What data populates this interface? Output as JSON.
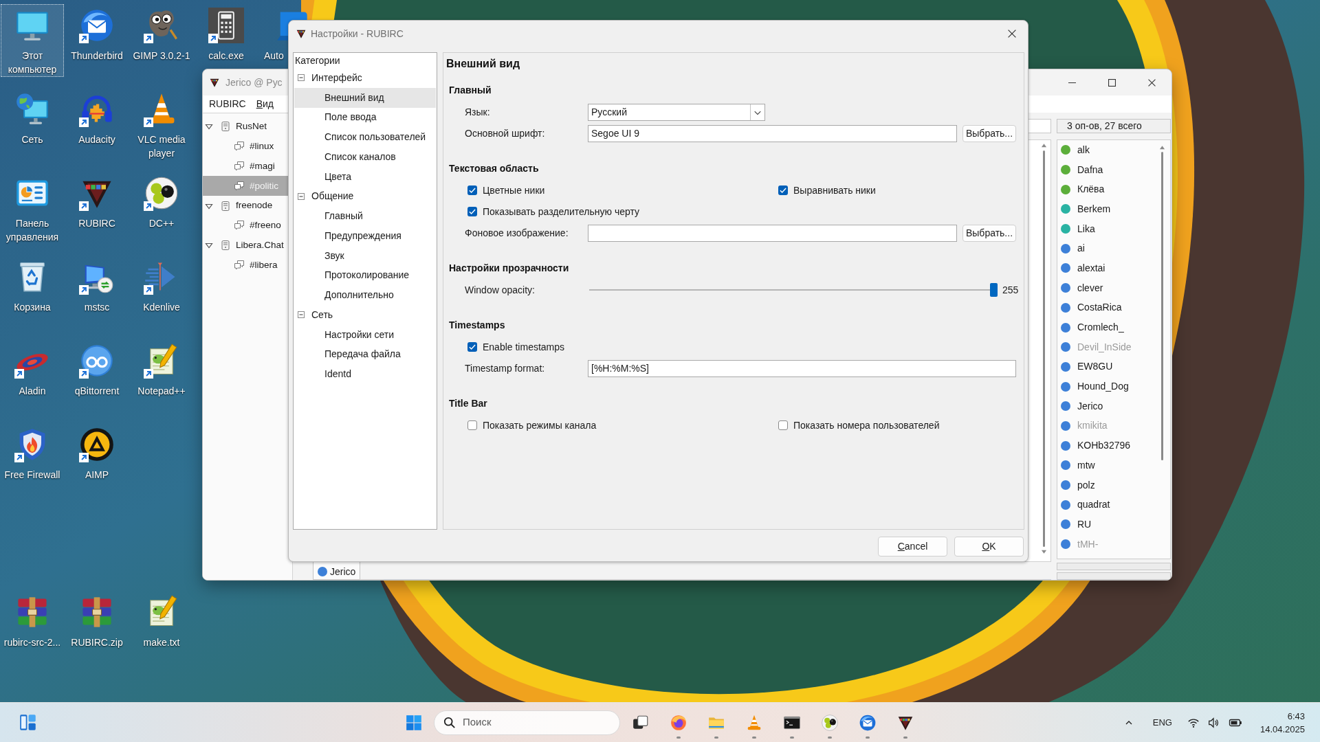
{
  "desktop": {
    "columns": [
      [
        {
          "label": "Этот компьютер",
          "shortcut": false,
          "selected": true
        },
        {
          "label": "Сеть",
          "shortcut": false,
          "selected": false
        },
        {
          "label": "Панель управления",
          "shortcut": false,
          "selected": false
        },
        {
          "label": "Корзина",
          "shortcut": false,
          "selected": false
        },
        {
          "label": "Aladin",
          "shortcut": true,
          "selected": false
        },
        {
          "label": "Free Firewall",
          "shortcut": true,
          "selected": false
        }
      ],
      [
        {
          "label": "Thunderbird",
          "shortcut": true,
          "selected": false
        },
        {
          "label": "Audacity",
          "shortcut": true,
          "selected": false
        },
        {
          "label": "RUBIRC",
          "shortcut": true,
          "selected": false
        },
        {
          "label": "mstsc",
          "shortcut": true,
          "selected": false
        },
        {
          "label": "qBittorrent",
          "shortcut": true,
          "selected": false
        },
        {
          "label": "AIMP",
          "shortcut": true,
          "selected": false
        }
      ],
      [
        {
          "label": "GIMP 3.0.2-1",
          "shortcut": true,
          "selected": false
        },
        {
          "label": "VLC media player",
          "shortcut": true,
          "selected": false
        },
        {
          "label": "DC++",
          "shortcut": true,
          "selected": false
        },
        {
          "label": "Kdenlive",
          "shortcut": true,
          "selected": false
        },
        {
          "label": "Notepad++",
          "shortcut": true,
          "selected": false
        }
      ],
      [
        {
          "label": "calc.exe",
          "shortcut": true,
          "selected": false
        }
      ],
      [
        {
          "label": "Auto",
          "shortcut": false,
          "selected": false
        }
      ]
    ],
    "bottom_row": [
      {
        "label": "rubirc-src-2...",
        "shortcut": false,
        "selected": false
      },
      {
        "label": "RUBIRC.zip",
        "shortcut": false,
        "selected": false
      },
      {
        "label": "make.txt",
        "shortcut": false,
        "selected": false
      }
    ]
  },
  "chat_window": {
    "title": "Jerico @ Рус",
    "menu": [
      {
        "label": "RUBIRC",
        "mnemonic": false
      },
      {
        "label": "Вид",
        "mnemonic": true
      }
    ],
    "server_tree": [
      {
        "label": "RusNet",
        "expanded": true,
        "selected": false,
        "children": [
          {
            "label": "#linux",
            "selected": false
          },
          {
            "label": "#magi",
            "selected": false
          },
          {
            "label": "#politic",
            "selected": true
          }
        ]
      },
      {
        "label": "freenode",
        "expanded": true,
        "selected": false,
        "children": [
          {
            "label": "#freeno",
            "selected": false
          }
        ]
      },
      {
        "label": "Libera.Chat",
        "expanded": true,
        "selected": false,
        "children": [
          {
            "label": "#libera",
            "selected": false
          }
        ]
      }
    ],
    "user_list": {
      "header": "3 оп-ов, 27 всего",
      "users": [
        {
          "nick": "alk",
          "color": "#5cae3a",
          "away": false
        },
        {
          "nick": "Dafna",
          "color": "#5cae3a",
          "away": false
        },
        {
          "nick": "Клёва",
          "color": "#5cae3a",
          "away": false
        },
        {
          "nick": "Berkem",
          "color": "#2ab3a3",
          "away": false
        },
        {
          "nick": "Lika",
          "color": "#2ab3a3",
          "away": false
        },
        {
          "nick": "ai",
          "color": "#3d80d8",
          "away": false
        },
        {
          "nick": "alextai",
          "color": "#3d80d8",
          "away": false
        },
        {
          "nick": "clever",
          "color": "#3d80d8",
          "away": false
        },
        {
          "nick": "CostaRica",
          "color": "#3d80d8",
          "away": false
        },
        {
          "nick": "Cromlech_",
          "color": "#3d80d8",
          "away": false
        },
        {
          "nick": "Devil_InSide",
          "color": "#3d80d8",
          "away": true
        },
        {
          "nick": "EW8GU",
          "color": "#3d80d8",
          "away": false
        },
        {
          "nick": "Hound_Dog",
          "color": "#3d80d8",
          "away": false
        },
        {
          "nick": "Jerico",
          "color": "#3d80d8",
          "away": false
        },
        {
          "nick": "kmikita",
          "color": "#3d80d8",
          "away": true
        },
        {
          "nick": "KOHb32796",
          "color": "#3d80d8",
          "away": false
        },
        {
          "nick": "mtw",
          "color": "#3d80d8",
          "away": false
        },
        {
          "nick": "polz",
          "color": "#3d80d8",
          "away": false
        },
        {
          "nick": "quadrat",
          "color": "#3d80d8",
          "away": false
        },
        {
          "nick": "RU",
          "color": "#3d80d8",
          "away": false
        },
        {
          "nick": "tMH-",
          "color": "#3d80d8",
          "away": true
        }
      ]
    },
    "channel_tabs": [
      {
        "label": "Jerico",
        "color": "#3d80d8",
        "selected": true
      }
    ]
  },
  "settings_dialog": {
    "title": "Настройки - RUBIRC",
    "categories": {
      "header": "Категории",
      "groups": [
        {
          "label": "Интерфейс",
          "expanded": true,
          "selected": false,
          "children": [
            {
              "label": "Внешний вид",
              "selected": true
            },
            {
              "label": "Поле ввода",
              "selected": false
            },
            {
              "label": "Список пользователей",
              "selected": false
            },
            {
              "label": "Список каналов",
              "selected": false
            },
            {
              "label": "Цвета",
              "selected": false
            }
          ]
        },
        {
          "label": "Общение",
          "expanded": true,
          "selected": false,
          "children": [
            {
              "label": "Главный",
              "selected": false
            },
            {
              "label": "Предупреждения",
              "selected": false
            },
            {
              "label": "Звук",
              "selected": false
            },
            {
              "label": "Протоколирование",
              "selected": false
            },
            {
              "label": "Дополнительно",
              "selected": false
            }
          ]
        },
        {
          "label": "Сеть",
          "expanded": true,
          "selected": false,
          "children": [
            {
              "label": "Настройки сети",
              "selected": false
            },
            {
              "label": "Передача файла",
              "selected": false
            },
            {
              "label": "Identd",
              "selected": false
            }
          ]
        }
      ]
    },
    "page": {
      "title": "Внешний вид",
      "sections": [
        {
          "title": "Главный",
          "rows": [
            {
              "kind": "dropdown",
              "label": "Язык:",
              "value": "Русский"
            },
            {
              "kind": "field",
              "label": "Основной шрифт:",
              "value": "Segoe UI 9",
              "button": "Выбрать..."
            }
          ]
        },
        {
          "title": "Текстовая область",
          "rows": [
            {
              "kind": "checkboxes",
              "items": [
                {
                  "label": "Цветные ники",
                  "checked": true
                },
                {
                  "label": "Выравнивать ники",
                  "checked": true
                }
              ]
            },
            {
              "kind": "checkboxes",
              "items": [
                {
                  "label": "Показывать разделительную черту",
                  "checked": true
                }
              ]
            },
            {
              "kind": "field",
              "label": "Фоновое изображение:",
              "button": "Выбрать..."
            }
          ]
        },
        {
          "title": "Настройки прозрачности",
          "rows": [
            {
              "kind": "slider",
              "label": "Window opacity:",
              "level": 1,
              "reading": "255"
            }
          ]
        },
        {
          "title": "Timestamps",
          "rows": [
            {
              "kind": "checkboxes",
              "items": [
                {
                  "label": "Enable timestamps",
                  "checked": true
                }
              ]
            },
            {
              "kind": "field",
              "label": "Timestamp format:",
              "value": "[%H:%M:%S]"
            }
          ]
        },
        {
          "title": "Title Bar",
          "rows": [
            {
              "kind": "checkboxes",
              "items": [
                {
                  "label": "Показать режимы канала",
                  "checked": false
                },
                {
                  "label": "Показать номера пользователей",
                  "checked": false
                }
              ]
            }
          ]
        }
      ]
    },
    "buttons": [
      {
        "label": "Cancel",
        "mnemonic": true
      },
      {
        "label": "OK",
        "mnemonic": true
      }
    ]
  },
  "taskbar": {
    "search": {
      "placeholder": "Поиск"
    },
    "apps": [
      {
        "running": true
      },
      {
        "running": true
      },
      {
        "running": true
      },
      {
        "running": true
      },
      {
        "running": true
      },
      {
        "running": true
      },
      {
        "running": true
      }
    ],
    "language": "ENG",
    "time": "6:43",
    "date": "14.04.2025"
  }
}
